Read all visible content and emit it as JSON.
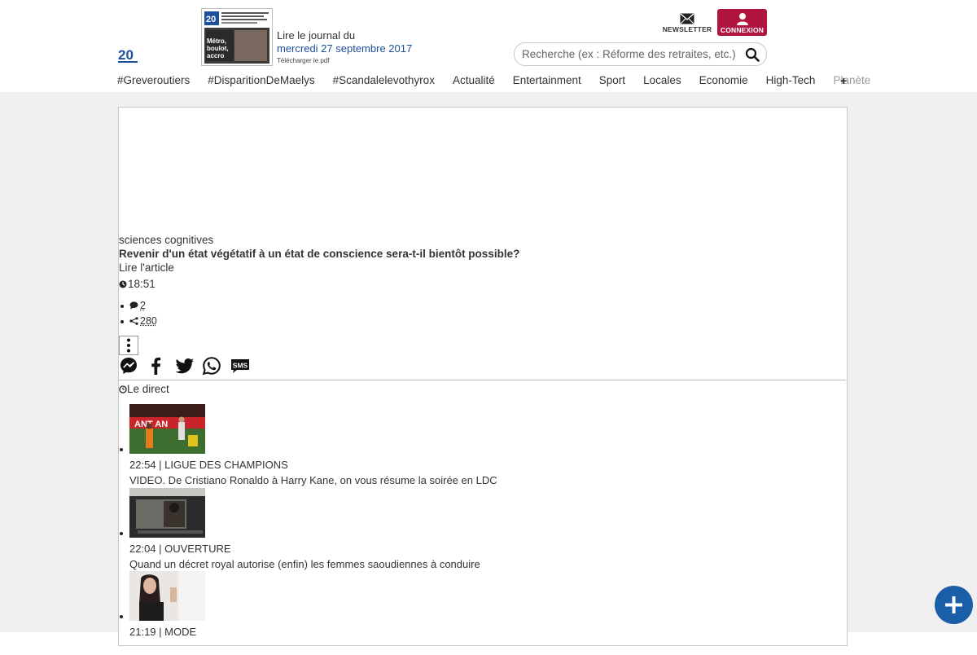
{
  "header": {
    "logo_text": "20",
    "journal": {
      "line1": "Lire le journal du",
      "date": "mercredi 27 septembre 2017",
      "download": "Télécharger le pdf",
      "cover_headline": "Métro, boulot, accro"
    },
    "newsletter_label": "NEWSLETTER",
    "connexion_label": "CONNEXION",
    "search_placeholder": "Recherche (ex : Réforme des retraites, etc.)",
    "brand_color": "#b0153f"
  },
  "nav": {
    "items": [
      "#Greveroutiers",
      "#DisparitionDeMaelys",
      "#Scandalelevothyrox",
      "Actualité",
      "Entertainment",
      "Sport",
      "Locales",
      "Economie",
      "High-Tech",
      "Planète"
    ],
    "more": "+"
  },
  "article": {
    "rubric": "sciences cognitives",
    "headline": "Revenir d'un état végétatif à un état de conscience sera-t-il bientôt possible?",
    "read_more": "Lire l'article",
    "time": "18:51",
    "comments": "2",
    "shares": "280"
  },
  "share_buttons": [
    "messenger-icon",
    "facebook-icon",
    "twitter-icon",
    "whatsapp-icon",
    "sms-icon"
  ],
  "direct": {
    "label": "Le direct",
    "items": [
      {
        "meta": "22:54 | LIGUE DES CHAMPIONS",
        "title": "VIDEO. De Cristiano Ronaldo à Harry Kane, on vous résume la soirée en LDC"
      },
      {
        "meta": "22:04 | OUVERTURE",
        "title": "Quand un décret royal autorise (enfin) les femmes saoudiennes à conduire"
      },
      {
        "meta": "21:19 | MODE",
        "title": ""
      }
    ]
  },
  "fab_color": "#1a5ea8"
}
